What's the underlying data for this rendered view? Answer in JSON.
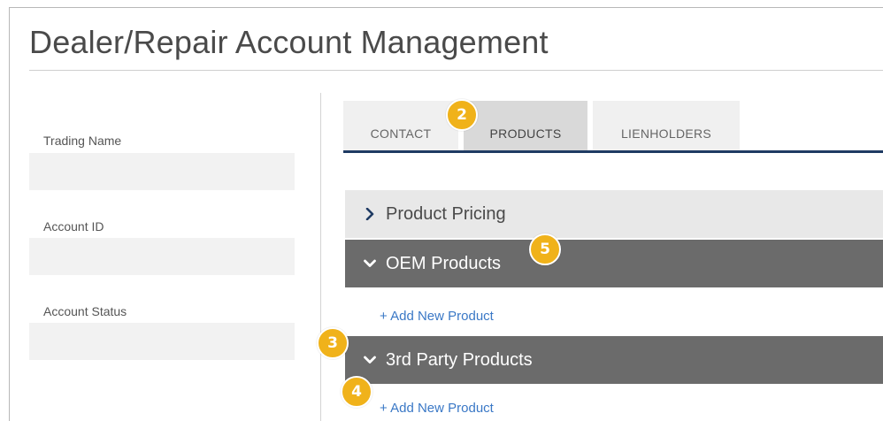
{
  "page": {
    "title": "Dealer/Repair Account Management"
  },
  "fields": [
    {
      "label": "Trading Name",
      "value": ""
    },
    {
      "label": "Account ID",
      "value": ""
    },
    {
      "label": "Account Status",
      "value": ""
    }
  ],
  "tabs": [
    {
      "label": "CONTACT",
      "active": false
    },
    {
      "label": "PRODUCTS",
      "active": true
    },
    {
      "label": "LIENHOLDERS",
      "active": false
    }
  ],
  "sections": [
    {
      "label": "Product Pricing",
      "expanded": false
    },
    {
      "label": "OEM Products",
      "expanded": true,
      "add_label": "+ Add New Product"
    },
    {
      "label": "3rd Party Products",
      "expanded": true,
      "add_label": "+ Add New Product"
    }
  ],
  "badges": [
    "2",
    "5",
    "3",
    "4"
  ],
  "colors": {
    "accent_badge": "#f0b21a",
    "tab_underline": "#1f3b63",
    "link": "#3a78c6",
    "section_dark": "#6b6b6b",
    "section_light": "#e8e8e8"
  }
}
